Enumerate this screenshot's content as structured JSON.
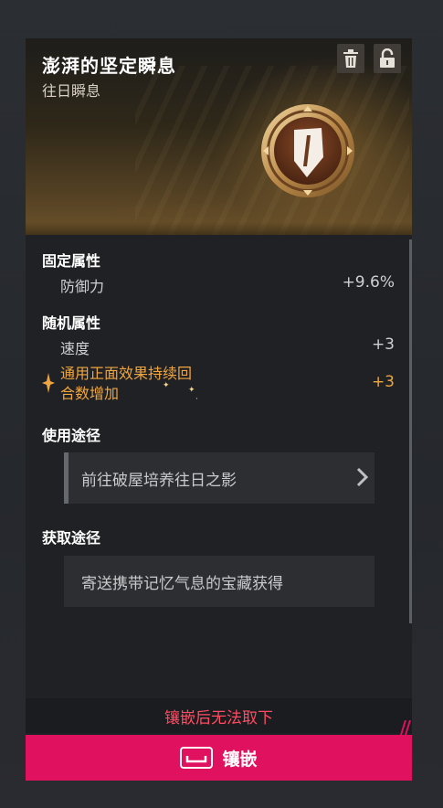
{
  "item": {
    "name": "澎湃的坚定瞬息",
    "category": "往日瞬息"
  },
  "fixed_attributes": {
    "heading": "固定属性",
    "items": [
      {
        "name": "防御力",
        "value": "+9.6%"
      }
    ]
  },
  "random_attributes": {
    "heading": "随机属性",
    "items": [
      {
        "name": "速度",
        "value": "+3"
      }
    ],
    "special": {
      "name_line1": "通用正面效果持续回",
      "name_line2": "合数增加",
      "value": "+3"
    }
  },
  "usage": {
    "heading": "使用途径",
    "path": "前往破屋培养往日之影"
  },
  "acquire": {
    "heading": "获取途径",
    "source": "寄送携带记忆气息的宝藏获得"
  },
  "warning": "镶嵌后无法取下",
  "embed_button": "镶嵌",
  "colors": {
    "accent": "#e0115f",
    "warning": "#ff4c62",
    "special_attr": "#f0a640"
  },
  "icons": [
    "trash-icon",
    "lock-icon",
    "shield-emblem-icon",
    "star-icon",
    "chevron-right-icon",
    "space-key-icon"
  ]
}
